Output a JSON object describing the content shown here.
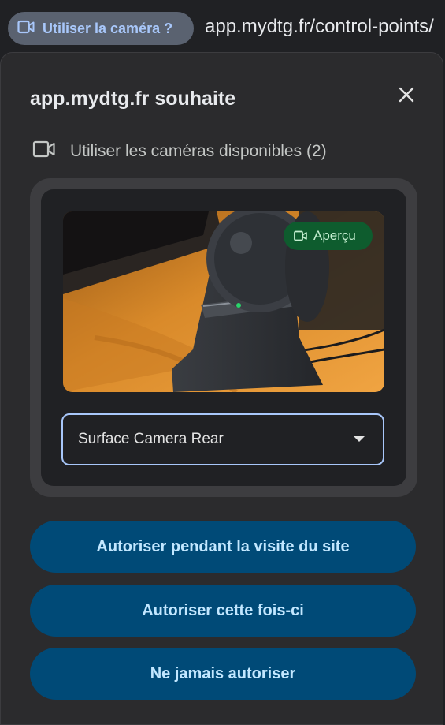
{
  "address_bar": {
    "chip_label": "Utiliser la caméra ?",
    "chip_icon": "video-camera-icon",
    "url": "app.mydtg.fr/control-points/"
  },
  "dialog": {
    "title": "app.mydtg.fr souhaite",
    "close_icon": "close-icon",
    "permission_icon": "video-camera-icon",
    "permission_text": "Utiliser les caméras disponibles (2)",
    "preview_badge": "Aperçu",
    "camera_select": {
      "selected": "Surface Camera Rear"
    },
    "buttons": {
      "allow_while_visiting": "Autoriser pendant la visite du site",
      "allow_this_time": "Autoriser cette fois-ci",
      "never_allow": "Ne jamais autoriser"
    }
  },
  "colors": {
    "accent": "#a8c7fa",
    "button_bg": "#004a77",
    "button_text": "#c2e7ff",
    "badge_bg": "#0e5c2e"
  }
}
